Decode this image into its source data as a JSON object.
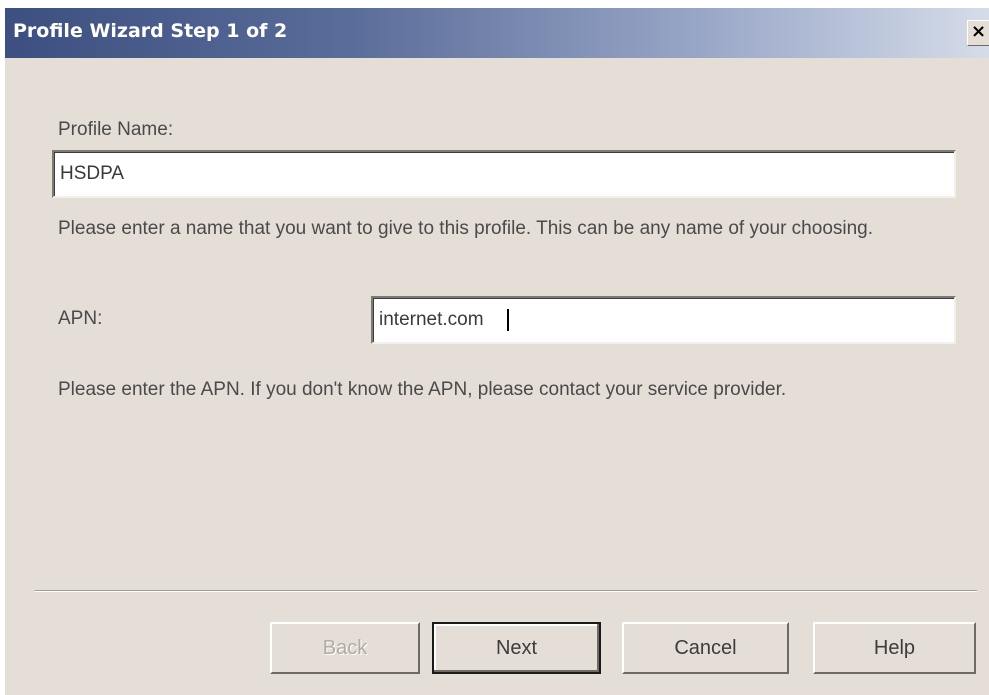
{
  "window": {
    "title": "Profile Wizard Step 1 of 2",
    "close_glyph": "×"
  },
  "form": {
    "profile_name_label": "Profile Name:",
    "profile_name_value": "HSDPA",
    "profile_name_help": "Please enter a name that you want to give to this profile. This can be any name of your choosing.",
    "apn_label": "APN:",
    "apn_value": "internet.com",
    "apn_help": "Please enter the APN.  If you don't know the APN, please contact your service provider."
  },
  "buttons": {
    "back": "Back",
    "next": "Next",
    "cancel": "Cancel",
    "help": "Help"
  },
  "colors": {
    "dialog_bg": "#e4ded6",
    "title_start": "#3d4f80",
    "title_end": "#d5dce9"
  }
}
